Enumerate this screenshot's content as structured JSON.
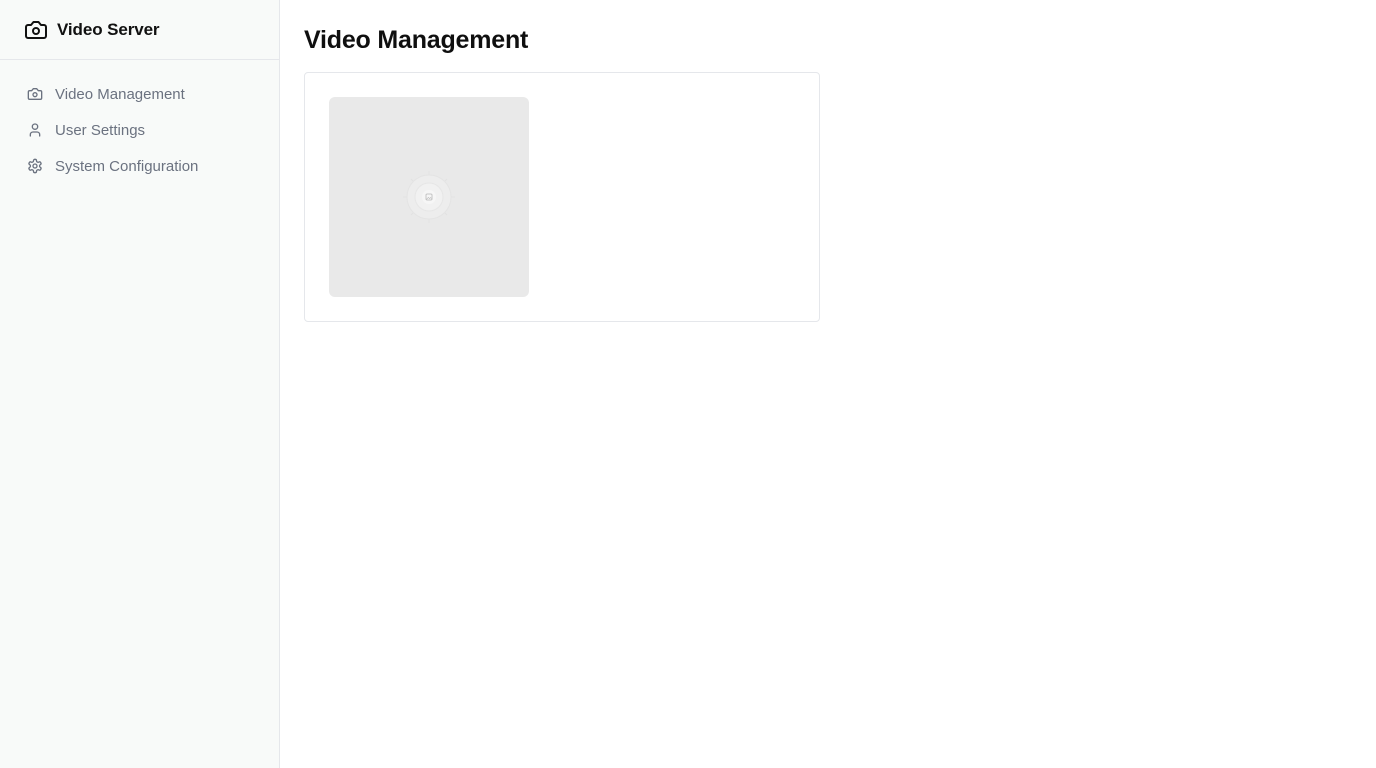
{
  "brand": {
    "title": "Video Server",
    "icon": "camera-icon"
  },
  "sidebar": {
    "items": [
      {
        "label": "Video Management",
        "icon": "camera-icon"
      },
      {
        "label": "User Settings",
        "icon": "user-icon"
      },
      {
        "label": "System Configuration",
        "icon": "gear-icon"
      }
    ]
  },
  "main": {
    "title": "Video Management",
    "videos": [
      {
        "thumbnail_icon": "image-placeholder-icon"
      }
    ]
  },
  "colors": {
    "sidebar_bg": "#f8faf9",
    "nav_text": "#6b7280",
    "thumbnail_bg": "#e9e9e9"
  }
}
